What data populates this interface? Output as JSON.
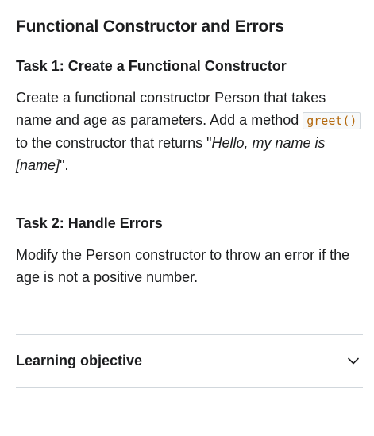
{
  "page": {
    "title": "Functional Constructor and Errors"
  },
  "task1": {
    "heading": "Task 1: Create a Functional Constructor",
    "text_before_code": "Create a functional constructor Person that takes name and age as parameters. Add a method ",
    "code": "greet()",
    "text_after_code": " to the constructor that returns \"",
    "italic": "Hello, my name is [name]",
    "text_end": "\"."
  },
  "task2": {
    "heading": "Task 2: Handle Errors",
    "text": "Modify the Person constructor to throw an error if the age is not a positive number."
  },
  "accordion": {
    "label": "Learning objective",
    "icon": "chevron-down-icon"
  },
  "colors": {
    "text": "#1c1d1f",
    "code_text": "#b4690e",
    "divider": "#d1d7dc"
  }
}
